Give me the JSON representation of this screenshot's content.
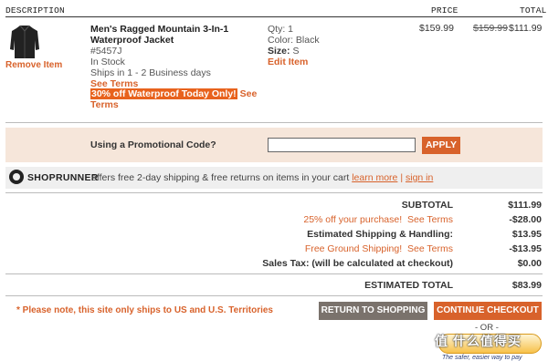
{
  "header": {
    "description": "DESCRIPTION",
    "price": "PRICE",
    "total": "TOTAL"
  },
  "item": {
    "name": "Men's Ragged Mountain 3-In-1 Waterproof Jacket",
    "sku": "#5457J",
    "stock": "In Stock",
    "ships": "Ships in 1 - 2 Business days",
    "see_terms": "See Terms",
    "promo_highlight": "30% off Waterproof Today Only!",
    "promo_see": "See",
    "promo_terms": "Terms",
    "remove": "Remove Item",
    "qty": "Qty: 1",
    "color": "Color: Black",
    "size_label": "Size:",
    "size_value": "S",
    "edit": "Edit Item",
    "price": "$159.99",
    "total_old": "$159.99",
    "total_new": "$111.99",
    "thumb_icon": "jacket-icon"
  },
  "promo_code": {
    "label": "Using a Promotional Code?",
    "value": "",
    "apply": "APPLY"
  },
  "shoprunner": {
    "name": "SHOPRUNNER",
    "text": "offers free 2-day shipping & free returns on items in your cart",
    "learn_more": "learn more",
    "divider": "|",
    "sign_in": "sign in",
    "logo_icon": "shoprunner-logo-icon"
  },
  "summary": {
    "subtotal_label": "SUBTOTAL",
    "subtotal_value": "$111.99",
    "discount_label": "25% off your purchase!",
    "discount_terms": "See Terms",
    "discount_value": "-$28.00",
    "shipping_label": "Estimated Shipping & Handling:",
    "shipping_value": "$13.95",
    "free_ship_label": "Free Ground Shipping!",
    "free_ship_terms": "See Terms",
    "free_ship_value": "-$13.95",
    "tax_label": "Sales Tax: (will be calculated at checkout)",
    "tax_value": "$0.00",
    "estimated_label": "ESTIMATED TOTAL",
    "estimated_value": "$83.99"
  },
  "footer": {
    "note": "* Please note, this site only ships to US and U.S. Territories",
    "return_btn": "RETURN TO SHOPPING",
    "checkout_btn": "CONTINUE CHECKOUT",
    "or": "- OR -",
    "paypal_caption": "The safer, easier way to pay",
    "watermark": "值 什么值得买"
  },
  "colors": {
    "accent": "#d8622b",
    "promo_band": "#f6e6da",
    "return_button": "#7a726c"
  }
}
